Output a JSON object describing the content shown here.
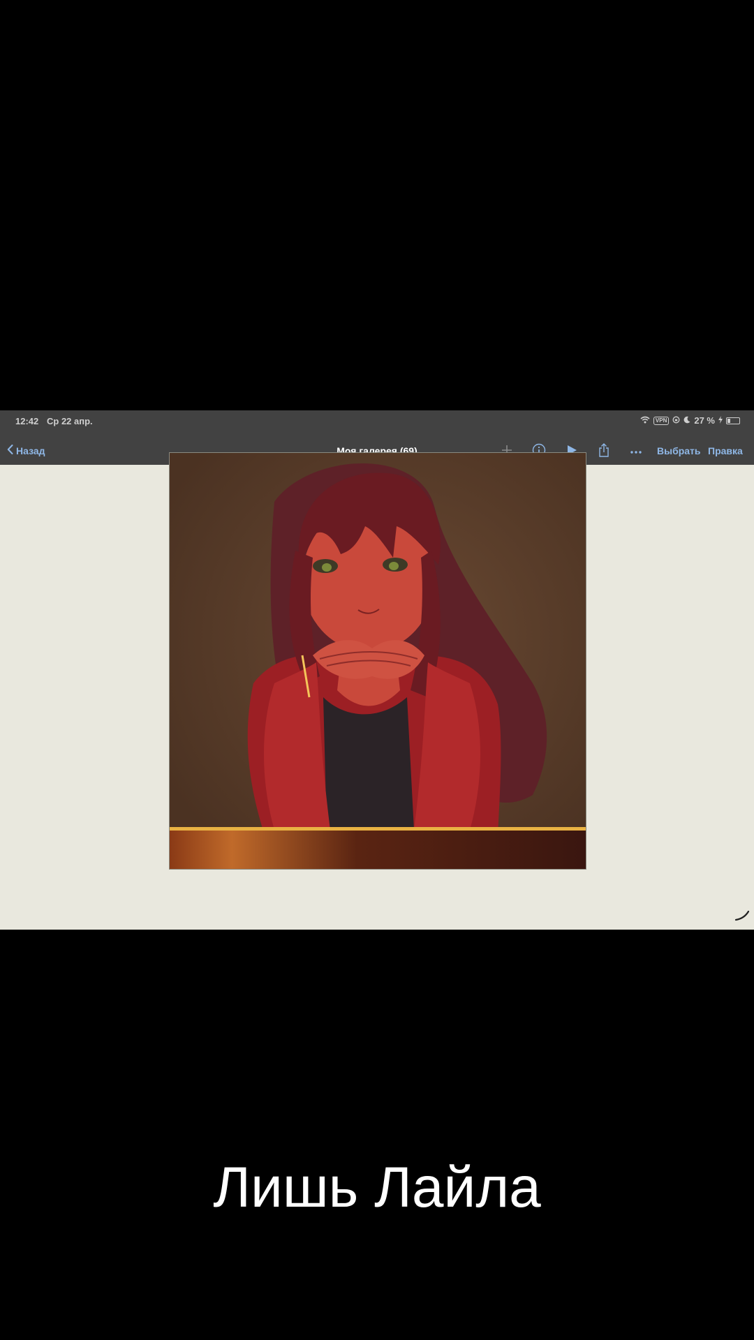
{
  "status_bar": {
    "time": "12:42",
    "date": "Ср 22 апр.",
    "vpn": "VPN",
    "battery": "27 %",
    "battery_level": 0.27
  },
  "nav": {
    "back_label": "Назад",
    "title": "Моя галерея (69)",
    "select_label": "Выбрать",
    "edit_label": "Правка"
  },
  "icons": {
    "add": "plus-icon",
    "info": "info-icon",
    "play": "play-icon",
    "share": "share-icon",
    "more": "more-icon"
  },
  "colors": {
    "accent": "#8fb7e6",
    "nav_background": "#424242",
    "canvas_background": "#e9e8de",
    "caption_text": "#ffffff"
  },
  "caption": "Лишь Лайла"
}
